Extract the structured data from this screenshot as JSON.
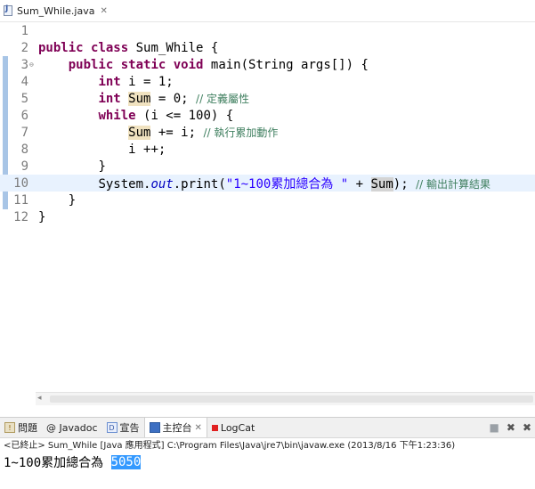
{
  "editor_tab": {
    "filename": "Sum_While.java",
    "close": "✕"
  },
  "code_lines": [
    {
      "num": "1"
    },
    {
      "num": "2",
      "kw1": "public",
      "kw2": "class",
      "rest": " Sum_While {"
    },
    {
      "num": "3",
      "fold": "⊖",
      "kw1": "public",
      "kw2": "static",
      "kw3": "void",
      "rest": " main(String args[]) {"
    },
    {
      "num": "4",
      "kw": "int",
      "rest": " i = 1;"
    },
    {
      "num": "5",
      "kw": "int",
      "var": "Sum",
      "rest": " = 0; ",
      "comment": "// 定義屬性"
    },
    {
      "num": "6",
      "kw": "while",
      "rest": " (i <= 100) {"
    },
    {
      "num": "7",
      "var": "Sum",
      "rest": " += i; ",
      "comment": "// 執行累加動作"
    },
    {
      "num": "8",
      "rest": "i ++;"
    },
    {
      "num": "9",
      "rest": "}"
    },
    {
      "num": "10",
      "a": "System.",
      "field": "out",
      "b": ".print(",
      "str": "\"1~100累加總合為 \"",
      "c": " + ",
      "var": "Sum",
      "d": "); ",
      "comment": "// 輸出計算結果"
    },
    {
      "num": "11",
      "rest": "}"
    },
    {
      "num": "12",
      "rest": "}"
    }
  ],
  "views": {
    "tabs": [
      {
        "label": "問題"
      },
      {
        "label": "@ Javadoc"
      },
      {
        "label": "宣告"
      },
      {
        "label": "主控台",
        "close": "✕"
      },
      {
        "label": "LogCat"
      }
    ]
  },
  "console": {
    "header": "<已終止> Sum_While [Java 應用程式] C:\\Program Files\\Java\\jre7\\bin\\javaw.exe (2013/8/16 下午1:23:36)",
    "output_prefix": "1~100累加總合為 ",
    "output_value": "5050"
  },
  "colors": {
    "keyword": "#7f0055",
    "comment": "#3f7f5f",
    "string": "#2a00ff",
    "selection": "#3399ff"
  }
}
